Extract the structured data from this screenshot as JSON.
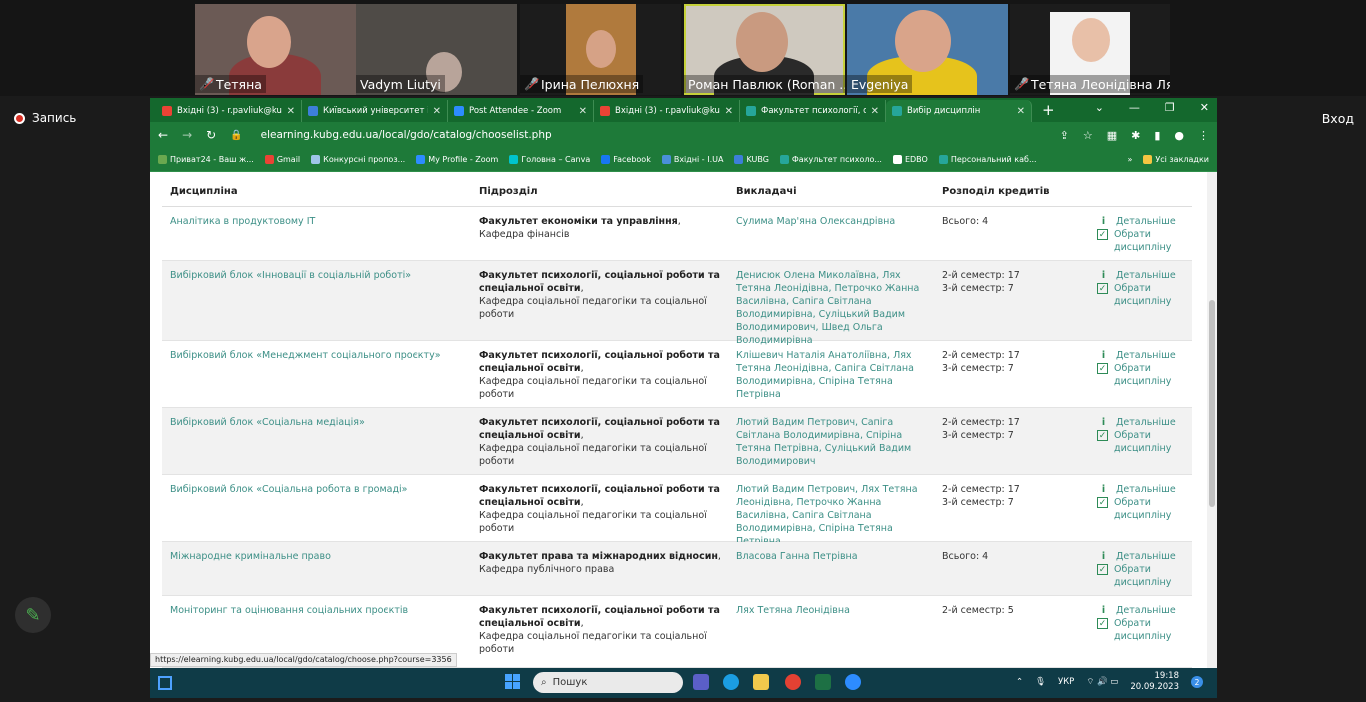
{
  "participants": [
    {
      "name": "Тетяна",
      "muted": true
    },
    {
      "name": "Vadym Liutyi",
      "muted": false
    },
    {
      "name": "Ірина Пелюхня",
      "muted": true
    },
    {
      "name": "Роман Павлюк (Roman ...",
      "muted": false,
      "active": true
    },
    {
      "name": "Evgeniya",
      "muted": false
    },
    {
      "name": "Тетяна Леонідівна Лях",
      "muted": true
    }
  ],
  "record_label": "Запись",
  "exit_label": "Вход",
  "browser": {
    "tabs": [
      {
        "label": "Вхідні (3) - r.pavliuk@kubg",
        "icon": "gmail-icon",
        "color": "#ea4335"
      },
      {
        "label": "Київський університет імені",
        "icon": "kubg-icon",
        "color": "#3d7fd9"
      },
      {
        "label": "Post Attendee - Zoom",
        "icon": "zoom-icon",
        "color": "#2d8cff"
      },
      {
        "label": "Вхідні (3) - r.pavliuk@kubg",
        "icon": "gmail-icon",
        "color": "#ea4335"
      },
      {
        "label": "Факультет психології, соціа",
        "icon": "moodle-icon",
        "color": "#26a69a"
      },
      {
        "label": "Вибір дисциплін",
        "icon": "moodle-icon",
        "color": "#26a69a"
      }
    ],
    "url": "elearning.kubg.edu.ua/local/gdo/catalog/chooselist.php",
    "bookmarks": [
      "Приват24 - Ваш ж...",
      "Gmail",
      "Конкурсні пропоз...",
      "My Profile - Zoom",
      "Головна – Canva",
      "Facebook",
      "Вхідні - I.UA",
      "KUBG",
      "Факультет психоло...",
      "EDBO",
      "Персональний каб..."
    ],
    "bookmarks_more": "»",
    "all_bookmarks": "Усі закладки",
    "status_url": "https://elearning.kubg.edu.ua/local/gdo/catalog/choose.php?course=3356"
  },
  "table": {
    "headers": [
      "Дисципліна",
      "Підрозділ",
      "Викладачі",
      "Розподіл кредитів"
    ],
    "action_details": "Детальніше",
    "action_choose": "Обрати дисципліну",
    "rows": [
      {
        "discipline": "Аналітика в продуктовому IT",
        "faculty": "Факультет економіки та управління",
        "dept": "Кафедра фінансів",
        "teachers": "Сулима Мар'яна Олександрівна",
        "credits": [
          "Всього: 4"
        ]
      },
      {
        "discipline": "Вибірковий блок «Інновації в соціальній роботі»",
        "faculty": "Факультет психології, соціальної роботи та спеціальної освіти",
        "dept": "Кафедра соціальної педагогіки та соціальної роботи",
        "teachers": "Денисюк Олена Миколаївна, Лях Тетяна Леонідівна, Петрочко Жанна Василівна, Сапіга Світлана Володимирівна, Суліцький Вадим Володимирович, Швед Ольга Володимирівна",
        "credits": [
          "2-й семестр: 17",
          "3-й семестр: 7"
        ]
      },
      {
        "discipline": "Вибірковий блок «Менеджмент соціального проєкту»",
        "faculty": "Факультет психології, соціальної роботи та спеціальної освіти",
        "dept": "Кафедра соціальної педагогіки та соціальної роботи",
        "teachers": "Клішевич Наталія Анатоліївна, Лях Тетяна Леонідівна, Сапіга Світлана Володимирівна, Спіріна Тетяна Петрівна",
        "credits": [
          "2-й семестр: 17",
          "3-й семестр: 7"
        ]
      },
      {
        "discipline": "Вибірковий блок «Соціальна медіація»",
        "faculty": "Факультет психології, соціальної роботи та спеціальної освіти",
        "dept": "Кафедра соціальної педагогіки та соціальної роботи",
        "teachers": "Лютий Вадим Петрович, Сапіга Світлана Володимирівна, Спіріна Тетяна Петрівна, Суліцький Вадим Володимирович",
        "credits": [
          "2-й семестр: 17",
          "3-й семестр: 7"
        ]
      },
      {
        "discipline": "Вибірковий блок «Соціальна робота в громаді»",
        "faculty": "Факультет психології, соціальної роботи та спеціальної освіти",
        "dept": "Кафедра соціальної педагогіки та соціальної роботи",
        "teachers": "Лютий Вадим Петрович, Лях Тетяна Леонідівна, Петрочко Жанна Василівна, Сапіга Світлана Володимирівна, Спіріна Тетяна Петрівна",
        "credits": [
          "2-й семестр: 17",
          "3-й семестр: 7"
        ]
      },
      {
        "discipline": "Міжнародне кримінальне право",
        "faculty": "Факультет права та міжнародних відносин",
        "dept": "Кафедра публічного права",
        "teachers": "Власова Ганна Петрівна",
        "credits": [
          "Всього: 4"
        ]
      },
      {
        "discipline": "Моніторинг та оцінювання соціальних проєктів",
        "faculty": "Факультет психології, соціальної роботи та спеціальної освіти",
        "dept": "Кафедра соціальної педагогіки та соціальної роботи",
        "teachers": "Лях Тетяна Леонідівна",
        "credits": [
          "2-й семестр: 5"
        ]
      }
    ]
  },
  "taskbar": {
    "search_placeholder": "Пошук",
    "lang": "УКР",
    "time": "19:18",
    "date": "20.09.2023",
    "notifications": "2"
  }
}
